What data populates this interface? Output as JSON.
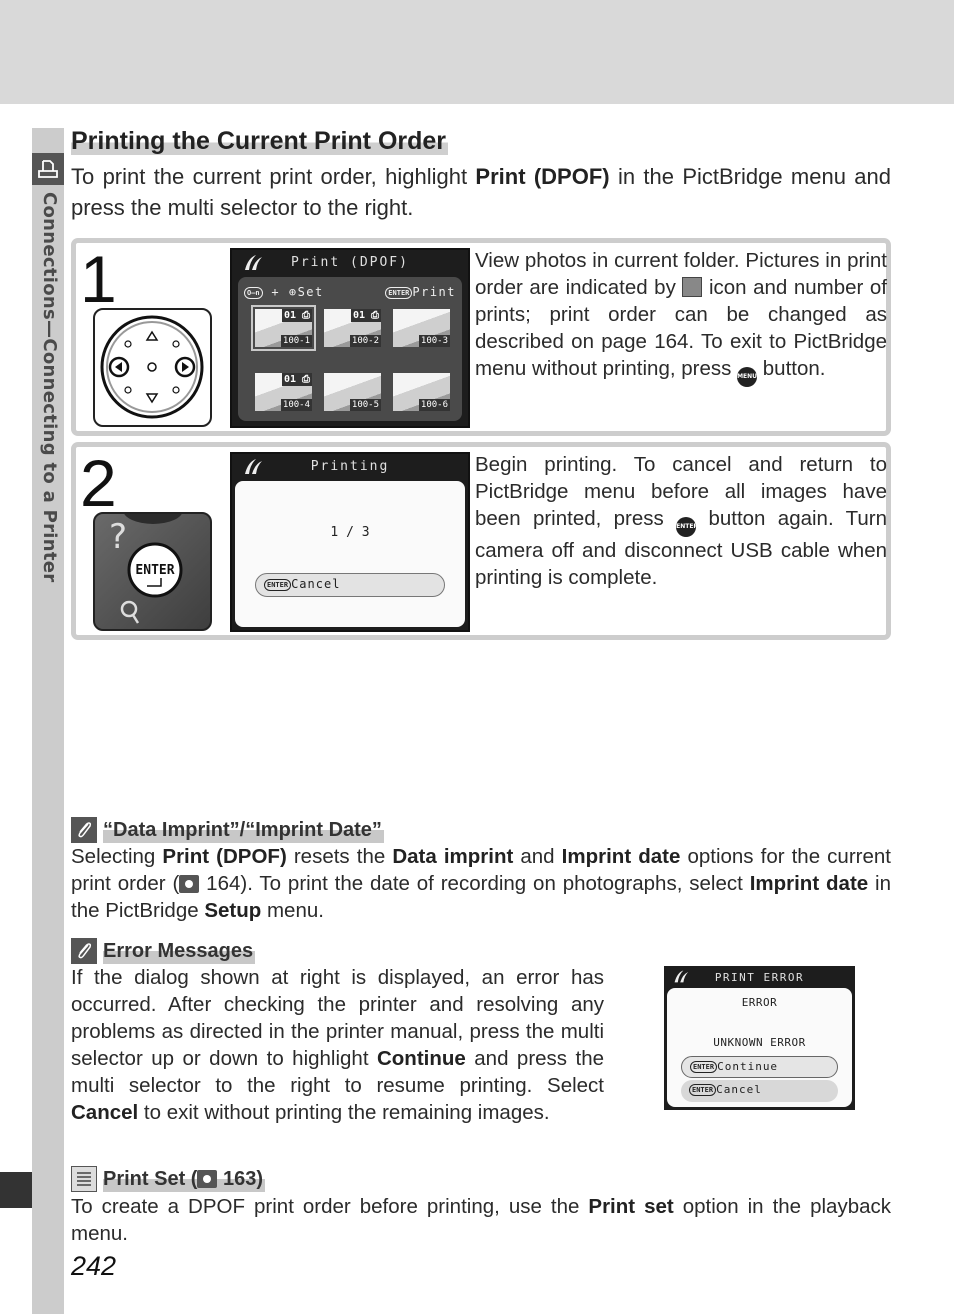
{
  "side": {
    "section_label": "Connections—Connecting to a Printer",
    "section_icon": "printer-icon"
  },
  "header": {
    "title": "Printing the Current Print Order",
    "intro_pre": "To print the current print order, highlight ",
    "intro_bold": "Print (DPOF)",
    "intro_post": " in the PictBridge menu and press the multi selector to the right."
  },
  "steps": [
    {
      "number": "1",
      "control_icon": "multi-selector-icon",
      "screen": {
        "title": "Print (DPOF)",
        "hint_left_key": "O–n",
        "hint_left": "+ ⊕Set",
        "hint_right_key": "ENTER",
        "hint_right": "Print",
        "thumbnails": [
          {
            "name": "100-1",
            "count": "01",
            "print_marked": true,
            "selected": true
          },
          {
            "name": "100-2",
            "count": "01",
            "print_marked": true,
            "selected": false
          },
          {
            "name": "100-3",
            "count": "",
            "print_marked": false,
            "selected": false
          },
          {
            "name": "100-4",
            "count": "01",
            "print_marked": true,
            "selected": false
          },
          {
            "name": "100-5",
            "count": "",
            "print_marked": false,
            "selected": false
          },
          {
            "name": "100-6",
            "count": "",
            "print_marked": false,
            "selected": false
          }
        ]
      },
      "text_a": "View photos in current folder.  Pictures in print order are indicated by ",
      "text_b": " icon and number of prints; print order can be changed as described on page 164. To exit to PictBridge menu without printing, press ",
      "text_c": " button.",
      "menu_button_label": "MENU"
    },
    {
      "number": "2",
      "control_icon": "enter-button-icon",
      "control_label": "ENTER",
      "screen": {
        "title": "Printing",
        "progress": "1 / 3",
        "progress_current": 1,
        "progress_total": 3,
        "button_key": "ENTER",
        "button_label": "Cancel"
      },
      "text_a": "Begin printing.  To cancel and return to PictBridge menu before all images have been printed, press ",
      "text_b": " button again.  Turn camera off and disconnect USB cable when printing is complete.",
      "enter_button_label": "ENTER"
    }
  ],
  "notes": [
    {
      "title": "“Data Imprint”/“Imprint Date”",
      "icon": "paperclip-icon",
      "p1": "Selecting ",
      "b1": "Print (DPOF)",
      "p2": " resets the ",
      "b2": "Data imprint",
      "p3": " and ",
      "b3": "Imprint date",
      "p4": " options for the current print order (",
      "ref": "164",
      "p5": ").  To print the date of recording on photographs, select ",
      "b4": "Imprint date",
      "p6": " in the PictBridge ",
      "b5": "Setup",
      "p7": " menu."
    },
    {
      "title": "Error Messages",
      "icon": "paperclip-icon",
      "p1": "If the dialog shown at right is displayed, an error has occurred.  After checking the printer and resolving any problems as directed in the printer manual, press the multi selector up or down to highlight ",
      "b1": "Continue",
      "p2": " and press the multi selector to the right to resume printing.  Select ",
      "b2": "Cancel",
      "p3": " to exit without printing the remaining images.",
      "dialog": {
        "title": "PRINT ERROR",
        "line1": "ERROR",
        "line2": "UNKNOWN ERROR",
        "key": "ENTER",
        "options": [
          "Continue",
          "Cancel"
        ],
        "selected": "Continue"
      }
    },
    {
      "title_pre": "Print Set (",
      "ref": "163",
      "title_post": ")",
      "icon": "playback-menu-icon",
      "p1": "To create a DPOF print order before printing, use the ",
      "b1": "Print set",
      "p2": " option in the playback menu."
    }
  ],
  "footer": {
    "page_number": "242"
  }
}
